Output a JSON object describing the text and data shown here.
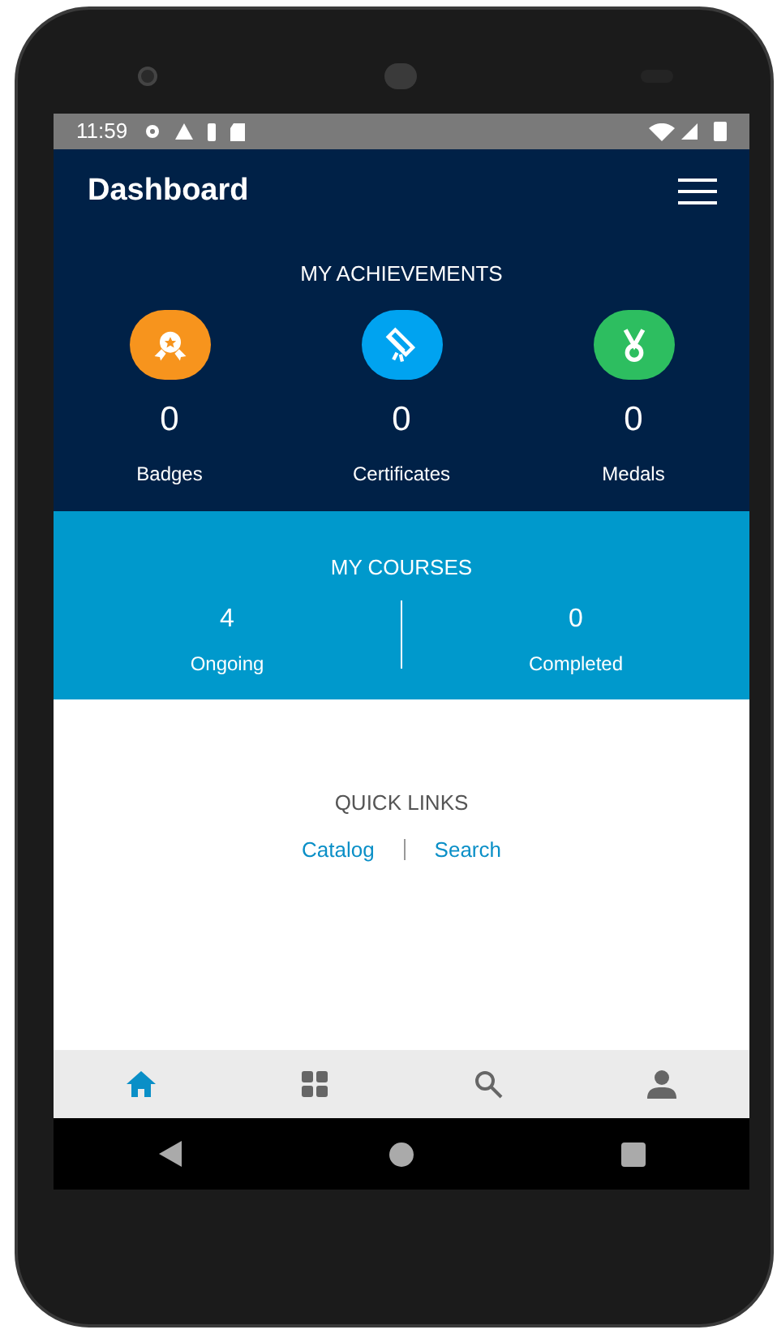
{
  "status_bar": {
    "time": "11:59"
  },
  "header": {
    "title": "Dashboard"
  },
  "achievements": {
    "title": "MY ACHIEVEMENTS",
    "items": [
      {
        "kind": "badge",
        "count": "0",
        "label": "Badges",
        "color": "#f7941d"
      },
      {
        "kind": "certificate",
        "count": "0",
        "label": "Certificates",
        "color": "#00a3f0"
      },
      {
        "kind": "medal",
        "count": "0",
        "label": "Medals",
        "color": "#2dbe60"
      }
    ]
  },
  "courses": {
    "title": "MY COURSES",
    "items": [
      {
        "count": "4",
        "label": "Ongoing"
      },
      {
        "count": "0",
        "label": "Completed"
      }
    ]
  },
  "quick_links": {
    "title": "QUICK LINKS",
    "links": [
      "Catalog",
      "Search"
    ]
  },
  "bottom_nav": [
    {
      "kind": "home",
      "selected": true
    },
    {
      "kind": "apps",
      "selected": false
    },
    {
      "kind": "search",
      "selected": false
    },
    {
      "kind": "profile",
      "selected": false
    }
  ]
}
